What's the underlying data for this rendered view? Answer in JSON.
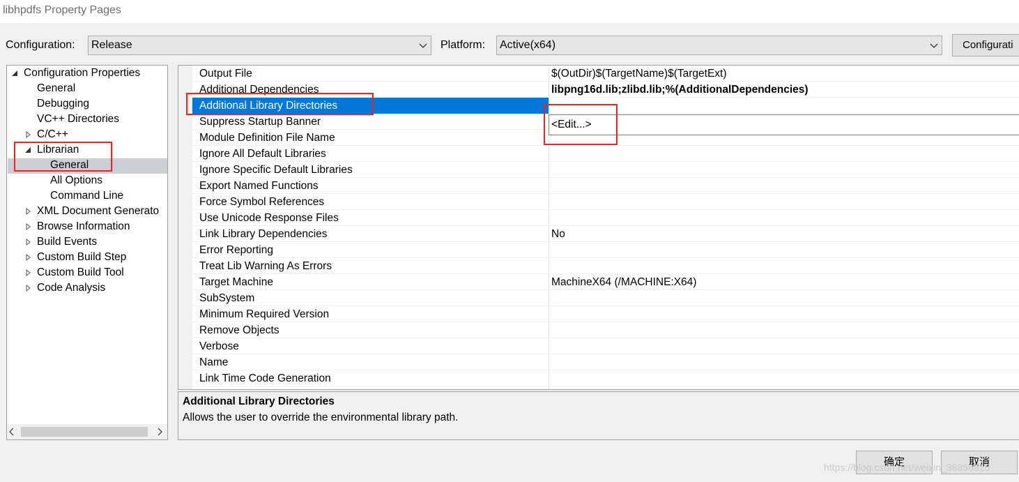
{
  "window": {
    "title": "libhpdfs Property Pages"
  },
  "toolbar": {
    "configuration_label": "Configuration:",
    "configuration_value": "Release",
    "platform_label": "Platform:",
    "platform_value": "Active(x64)",
    "config_manager_label": "Configurati"
  },
  "tree": {
    "items": [
      {
        "label": "Configuration Properties",
        "expander": "expanded"
      },
      {
        "label": "General",
        "expander": "none"
      },
      {
        "label": "Debugging",
        "expander": "none"
      },
      {
        "label": "VC++ Directories",
        "expander": "none"
      },
      {
        "label": "C/C++",
        "expander": "collapsed"
      },
      {
        "label": "Librarian",
        "expander": "expanded"
      },
      {
        "label": "General",
        "expander": "none",
        "selected": true
      },
      {
        "label": "All Options",
        "expander": "none"
      },
      {
        "label": "Command Line",
        "expander": "none"
      },
      {
        "label": "XML Document Generato",
        "expander": "collapsed"
      },
      {
        "label": "Browse Information",
        "expander": "collapsed"
      },
      {
        "label": "Build Events",
        "expander": "collapsed"
      },
      {
        "label": "Custom Build Step",
        "expander": "collapsed"
      },
      {
        "label": "Custom Build Tool",
        "expander": "collapsed"
      },
      {
        "label": "Code Analysis",
        "expander": "collapsed"
      }
    ]
  },
  "grid": {
    "rows": [
      {
        "name": "Output File",
        "value": "$(OutDir)$(TargetName)$(TargetExt)"
      },
      {
        "name": "Additional Dependencies",
        "value": "libpng16d.lib;zlibd.lib;%(AdditionalDependencies)",
        "bold": true
      },
      {
        "name": "Additional Library Directories",
        "value": "",
        "selected": true
      },
      {
        "name": "Suppress Startup Banner",
        "value": ""
      },
      {
        "name": "Module Definition File Name",
        "value": ""
      },
      {
        "name": "Ignore All Default Libraries",
        "value": ""
      },
      {
        "name": "Ignore Specific Default Libraries",
        "value": ""
      },
      {
        "name": "Export Named Functions",
        "value": ""
      },
      {
        "name": "Force Symbol References",
        "value": ""
      },
      {
        "name": "Use Unicode Response Files",
        "value": ""
      },
      {
        "name": "Link Library Dependencies",
        "value": "No"
      },
      {
        "name": "Error Reporting",
        "value": ""
      },
      {
        "name": "Treat Lib Warning As Errors",
        "value": ""
      },
      {
        "name": "Target Machine",
        "value": "MachineX64 (/MACHINE:X64)"
      },
      {
        "name": "SubSystem",
        "value": ""
      },
      {
        "name": "Minimum Required Version",
        "value": ""
      },
      {
        "name": "Remove Objects",
        "value": ""
      },
      {
        "name": "Verbose",
        "value": ""
      },
      {
        "name": "Name",
        "value": ""
      },
      {
        "name": "Link Time Code Generation",
        "value": ""
      }
    ],
    "dropdown_item": "<Edit...>"
  },
  "description": {
    "title": "Additional Library Directories",
    "body": "Allows the user to override the environmental library path."
  },
  "footer": {
    "ok_label": "确定",
    "cancel_label": "取消",
    "watermark": "https://blog.csdn.net/weixin_38856815"
  },
  "colors": {
    "selection": "#0078d7",
    "annotation_red": "#ff1e1e",
    "tree_selection": "#cdcdd6"
  }
}
